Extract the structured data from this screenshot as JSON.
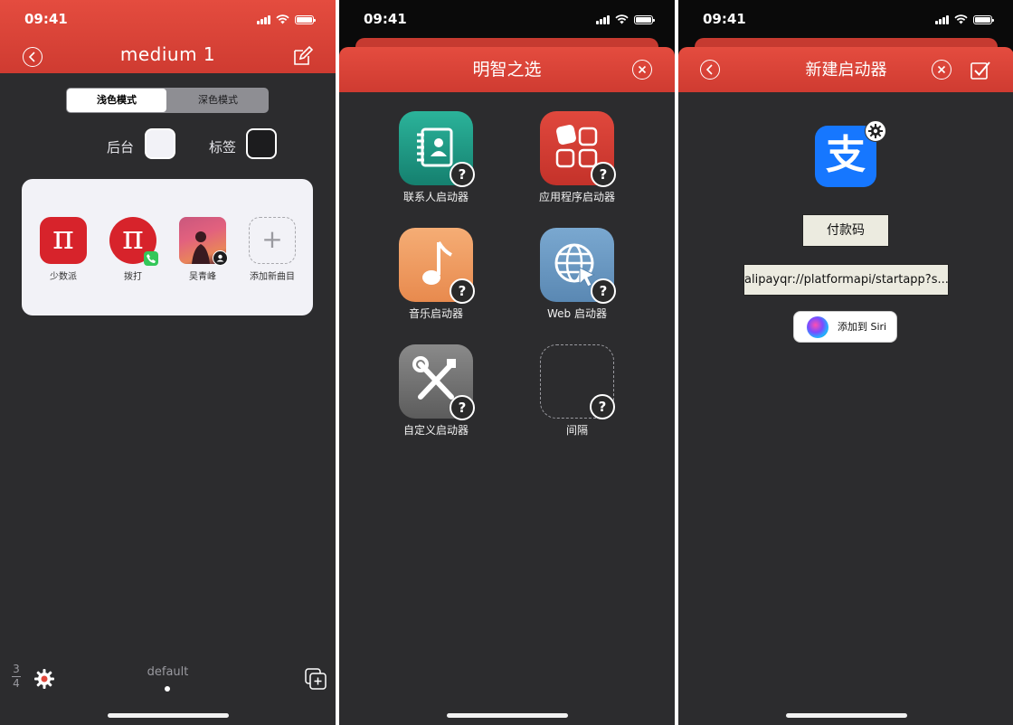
{
  "status": {
    "time": "09:41"
  },
  "screen1": {
    "title": "medium 1",
    "segments": [
      "浅色模式",
      "深色模式"
    ],
    "swatches": [
      {
        "label": "后台",
        "color": "#f2f2f7"
      },
      {
        "label": "标签",
        "color": "#1c1c1e"
      }
    ],
    "items": [
      {
        "label": "少数派",
        "glyph": "π"
      },
      {
        "label": "拨打",
        "glyph": "π"
      },
      {
        "label": "吴青峰"
      },
      {
        "label": "添加新曲目",
        "glyph": "+"
      }
    ],
    "page_top": "3",
    "page_bottom": "4",
    "profile_name": "default",
    "accent": "#e0463a"
  },
  "screen2": {
    "title": "明智之选",
    "items": [
      {
        "label": "联系人启动器",
        "color": "#1f9b87"
      },
      {
        "label": "应用程序启动器",
        "color": "#d9443a"
      },
      {
        "label": "音乐启动器",
        "color": "#f2a06a"
      },
      {
        "label": "Web 启动器",
        "color": "#6d9bc4"
      },
      {
        "label": "自定义启动器",
        "color": "#6f6f6f"
      },
      {
        "label": "间隔"
      }
    ],
    "help_glyph": "?"
  },
  "screen3": {
    "title": "新建启动器",
    "app_glyph": "支",
    "app_color": "#1677ff",
    "name_value": "付款码",
    "url_value": "alipayqr://platformapi/startapp?s...",
    "siri_label": "添加到 Siri"
  }
}
